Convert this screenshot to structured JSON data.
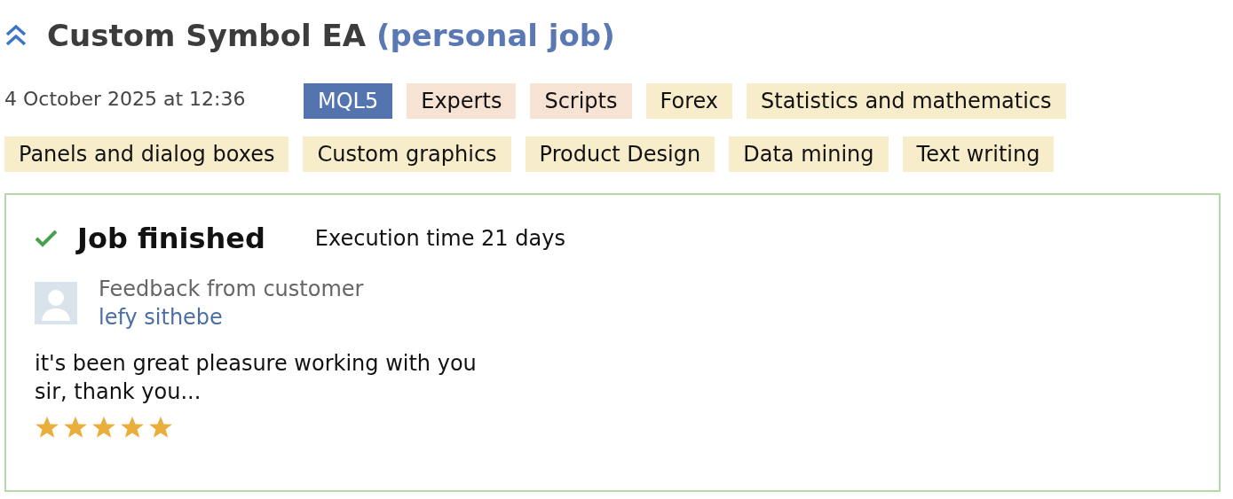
{
  "title": {
    "name": "Custom Symbol EA",
    "type": "(personal job)"
  },
  "date": "4 October 2025 at 12:36",
  "tags": [
    {
      "label": "MQL5",
      "kind": "platform"
    },
    {
      "label": "Experts",
      "kind": "category"
    },
    {
      "label": "Scripts",
      "kind": "category"
    },
    {
      "label": "Forex",
      "kind": "skill"
    },
    {
      "label": "Statistics and mathematics",
      "kind": "skill"
    },
    {
      "label": "Panels and dialog boxes",
      "kind": "skill"
    },
    {
      "label": "Custom graphics",
      "kind": "skill"
    },
    {
      "label": "Product Design",
      "kind": "skill"
    },
    {
      "label": "Data mining",
      "kind": "skill"
    },
    {
      "label": "Text writing",
      "kind": "skill"
    }
  ],
  "result": {
    "status": "Job finished",
    "execution": "Execution time 21 days",
    "feedback_label": "Feedback from customer",
    "customer": "lefy sithebe",
    "comment": "it's been great pleasure working with you\nsir, thank you...",
    "stars": 5
  }
}
